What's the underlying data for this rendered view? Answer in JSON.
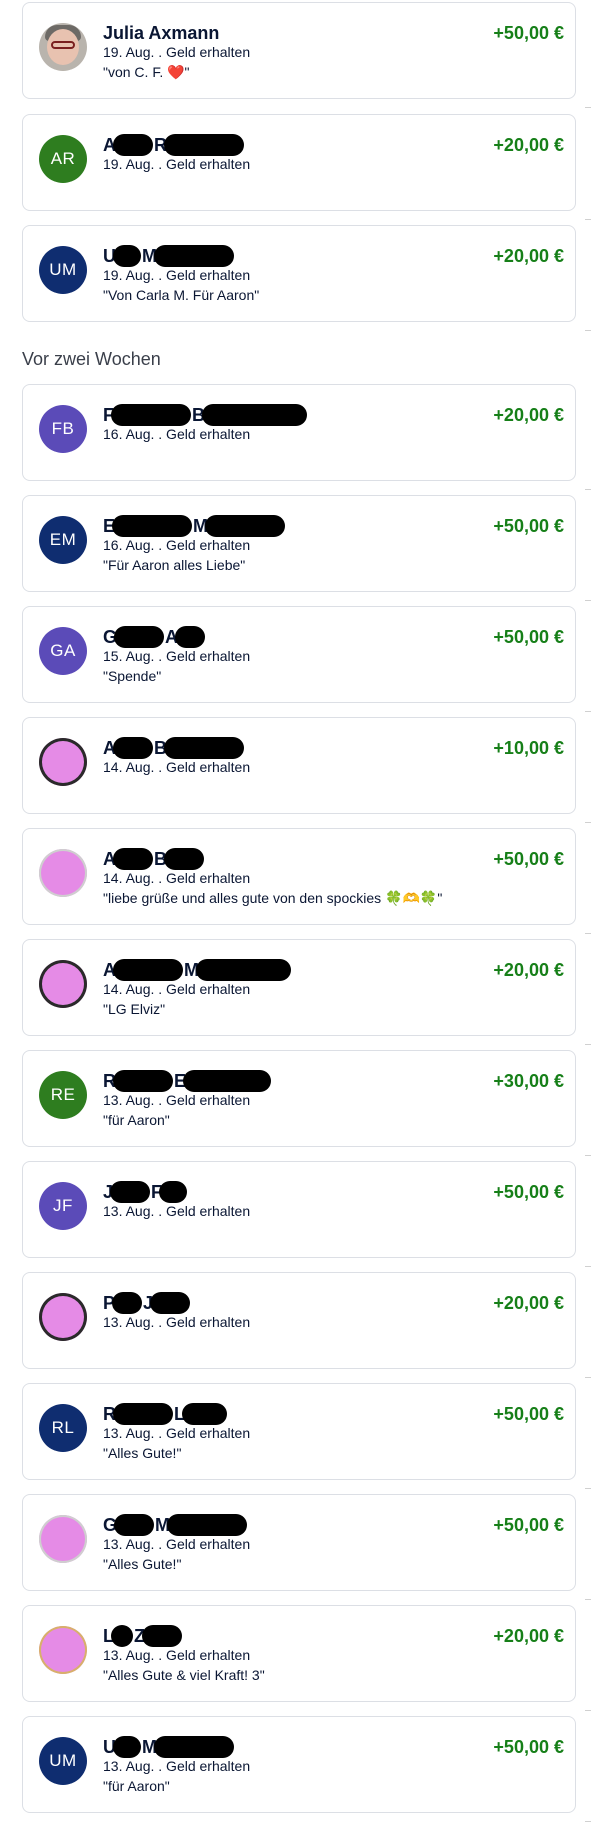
{
  "section_header": "Vor zwei Wochen",
  "colors": {
    "amount": "#167f18",
    "text": "#0a1633",
    "card_border": "#dcdfe5",
    "avatar_green": "#2e7d1f",
    "avatar_navy": "#0f2d70",
    "avatar_purple": "#5b4bb8",
    "avatar_pink": "#e58be6"
  },
  "transactions": [
    {
      "name_parts": [
        "Julia Axmann"
      ],
      "date": "19. Aug. . Geld erhalten",
      "note": "\"von C. F. ❤️\"",
      "amount": "+50,00 €",
      "avatar": "photo",
      "initials": ""
    },
    {
      "name_parts": [
        "A",
        "R"
      ],
      "date": "19. Aug. . Geld erhalten",
      "note": "",
      "amount": "+20,00 €",
      "avatar": "green",
      "initials": "AR"
    },
    {
      "name_parts": [
        "U",
        "M"
      ],
      "date": "19. Aug. . Geld erhalten",
      "note": "\"Von Carla M. Für Aaron\"",
      "amount": "+20,00 €",
      "avatar": "navy",
      "initials": "UM"
    },
    {
      "name_parts": [
        "F",
        "B"
      ],
      "date": "16. Aug. . Geld erhalten",
      "note": "",
      "amount": "+20,00 €",
      "avatar": "purple",
      "initials": "FB"
    },
    {
      "name_parts": [
        "E",
        "M"
      ],
      "date": "16. Aug. . Geld erhalten",
      "note": "\"Für Aaron alles Liebe\"",
      "amount": "+50,00 €",
      "avatar": "navy",
      "initials": "EM"
    },
    {
      "name_parts": [
        "G",
        "A"
      ],
      "date": "15. Aug. . Geld erhalten",
      "note": "\"Spende\"",
      "amount": "+50,00 €",
      "avatar": "purple",
      "initials": "GA"
    },
    {
      "name_parts": [
        "A",
        "B"
      ],
      "date": "14. Aug. . Geld erhalten",
      "note": "",
      "amount": "+10,00 €",
      "avatar": "pink",
      "initials": ""
    },
    {
      "name_parts": [
        "A",
        "B"
      ],
      "date": "14. Aug. . Geld erhalten",
      "note": "\"liebe grüße und alles gute von den spockies 🍀🫶🍀\"",
      "amount": "+50,00 €",
      "avatar": "pinklight",
      "initials": ""
    },
    {
      "name_parts": [
        "A",
        "M"
      ],
      "date": "14. Aug. . Geld erhalten",
      "note": "\"LG Elviz\"",
      "amount": "+20,00 €",
      "avatar": "pink",
      "initials": ""
    },
    {
      "name_parts": [
        "R",
        "E"
      ],
      "date": "13. Aug. . Geld erhalten",
      "note": "\"für Aaron\"",
      "amount": "+30,00 €",
      "avatar": "green",
      "initials": "RE"
    },
    {
      "name_parts": [
        "J",
        "F"
      ],
      "date": "13. Aug. . Geld erhalten",
      "note": "",
      "amount": "+50,00 €",
      "avatar": "purple",
      "initials": "JF"
    },
    {
      "name_parts": [
        "P",
        "J"
      ],
      "date": "13. Aug. . Geld erhalten",
      "note": "",
      "amount": "+20,00 €",
      "avatar": "pink",
      "initials": ""
    },
    {
      "name_parts": [
        "R",
        "L"
      ],
      "date": "13. Aug. . Geld erhalten",
      "note": "\"Alles Gute!\"",
      "amount": "+50,00 €",
      "avatar": "navy",
      "initials": "RL"
    },
    {
      "name_parts": [
        "G",
        "M"
      ],
      "date": "13. Aug. . Geld erhalten",
      "note": "\"Alles Gute!\"",
      "amount": "+50,00 €",
      "avatar": "pinklight",
      "initials": ""
    },
    {
      "name_parts": [
        "L",
        "Z"
      ],
      "date": "13. Aug. . Geld erhalten",
      "note": "\"Alles Gute & viel Kraft! 3\"",
      "amount": "+20,00 €",
      "avatar": "pinkgold",
      "initials": ""
    },
    {
      "name_parts": [
        "U",
        "M"
      ],
      "date": "13. Aug. . Geld erhalten",
      "note": "\"für Aaron\"",
      "amount": "+50,00 €",
      "avatar": "navy",
      "initials": "UM"
    }
  ]
}
